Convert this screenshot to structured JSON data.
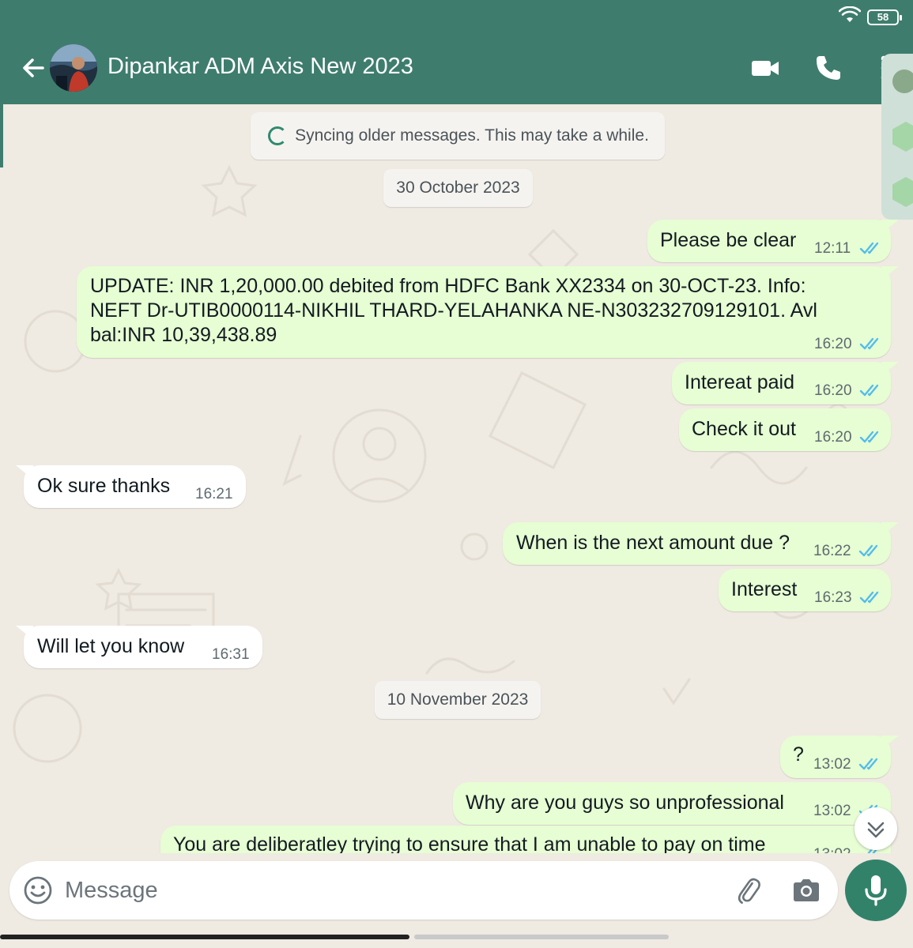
{
  "status_bar": {
    "battery": "58"
  },
  "header": {
    "title": "Dipankar ADM Axis New 2023"
  },
  "sync_notice": "Syncing older messages. This may take a while.",
  "dates": [
    "30 October 2023",
    "10 November 2023"
  ],
  "messages": [
    {
      "dir": "out",
      "text": "Please be clear",
      "time": "12:11"
    },
    {
      "dir": "out",
      "text": "UPDATE: INR 1,20,000.00 debited from HDFC Bank XX2334 on 30-OCT-23. Info: NEFT Dr-UTIB0000114-NIKHIL THARD-YELAHANKA NE-N303232709129101. Avl bal:INR 10,39,438.89",
      "time": "16:20"
    },
    {
      "dir": "out",
      "text": "Intereat paid",
      "time": "16:20"
    },
    {
      "dir": "out",
      "text": "Check it out",
      "time": "16:20"
    },
    {
      "dir": "in",
      "text": "Ok sure thanks",
      "time": "16:21"
    },
    {
      "dir": "out",
      "text": "When is the next amount due ?",
      "time": "16:22"
    },
    {
      "dir": "out",
      "text": "Interest",
      "time": "16:23"
    },
    {
      "dir": "in",
      "text": "Will let you know",
      "time": "16:31"
    },
    {
      "dir": "out",
      "text": "?",
      "time": "13:02"
    },
    {
      "dir": "out",
      "text": "Why are you guys so unprofessional",
      "time": "13:02"
    },
    {
      "dir": "out",
      "text": "You are deliberatley trying to ensure that I am unable to pay on time",
      "time": "13:02"
    }
  ],
  "composer": {
    "placeholder": "Message"
  },
  "icons": {
    "back": "arrow-left-icon",
    "video": "video-camera-icon",
    "call": "phone-icon",
    "menu": "more-vertical-icon",
    "emoji": "emoji-icon",
    "attach": "paperclip-icon",
    "camera": "camera-icon",
    "mic": "microphone-icon",
    "scroll": "chevron-double-down-icon",
    "read_receipt": "double-check-icon"
  },
  "colors": {
    "header": "#3e7d6d",
    "outgoing_bubble": "#e7fdd3",
    "incoming_bubble": "#ffffff",
    "chat_bg": "#efeae2",
    "read_tick": "#53bdeb",
    "mic_button": "#32826a"
  }
}
